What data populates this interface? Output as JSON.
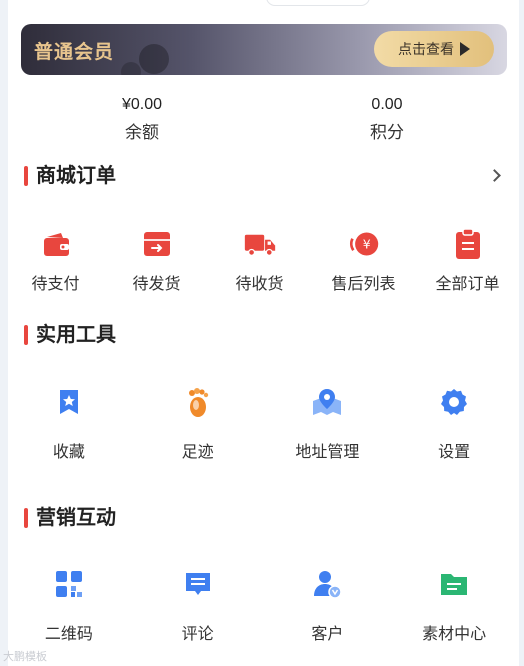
{
  "member": {
    "title": "普通会员",
    "button_label": "点击查看"
  },
  "stats": [
    {
      "value": "¥0.00",
      "label": "余额"
    },
    {
      "value": "0.00",
      "label": "积分"
    }
  ],
  "orders": {
    "title": "商城订单",
    "items": [
      {
        "label": "待支付",
        "icon": "wallet-icon"
      },
      {
        "label": "待发货",
        "icon": "box-icon"
      },
      {
        "label": "待收货",
        "icon": "truck-icon"
      },
      {
        "label": "售后列表",
        "icon": "refund-icon"
      },
      {
        "label": "全部订单",
        "icon": "clipboard-icon"
      }
    ]
  },
  "tools": {
    "title": "实用工具",
    "items": [
      {
        "label": "收藏",
        "icon": "favorite-icon"
      },
      {
        "label": "足迹",
        "icon": "footprint-icon"
      },
      {
        "label": "地址管理",
        "icon": "location-icon"
      },
      {
        "label": "设置",
        "icon": "gear-icon"
      }
    ]
  },
  "marketing": {
    "title": "营销互动",
    "items": [
      {
        "label": "二维码",
        "icon": "qrcode-icon"
      },
      {
        "label": "评论",
        "icon": "comment-icon"
      },
      {
        "label": "客户",
        "icon": "customer-icon"
      },
      {
        "label": "素材中心",
        "icon": "folder-icon"
      }
    ]
  },
  "colors": {
    "accent_red": "#e8463e",
    "gold": "#e8c58e",
    "blue": "#3f7ff0",
    "orange": "#f08a2a",
    "green": "#2bb673"
  },
  "watermark": "大鹏模板"
}
